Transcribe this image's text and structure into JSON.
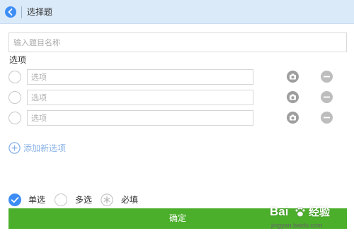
{
  "header": {
    "title": "选择题",
    "back_icon": "chevron-left-icon"
  },
  "question": {
    "name_placeholder": "输入题目名称",
    "name_value": ""
  },
  "options": {
    "section_label": "选项",
    "items": [
      {
        "placeholder": "选项",
        "value": "",
        "selected": false
      },
      {
        "placeholder": "选项",
        "value": "",
        "selected": false
      },
      {
        "placeholder": "选项",
        "value": "",
        "selected": false
      }
    ],
    "add_label": "添加新选项"
  },
  "mode": {
    "single_label": "单选",
    "multi_label": "多选",
    "required_label": "必填",
    "selected": "single"
  },
  "confirm_label": "确定",
  "watermark": {
    "logo_text": "Bai",
    "logo_text_2": "经验",
    "url": "jingyan.baidu.com"
  },
  "colors": {
    "accent": "#3d8df5",
    "header_bg": "#dbeaf9",
    "confirm_bg": "#4caf2c",
    "add_text": "#8ab3e6",
    "icon_gray": "#9e9e9e"
  }
}
